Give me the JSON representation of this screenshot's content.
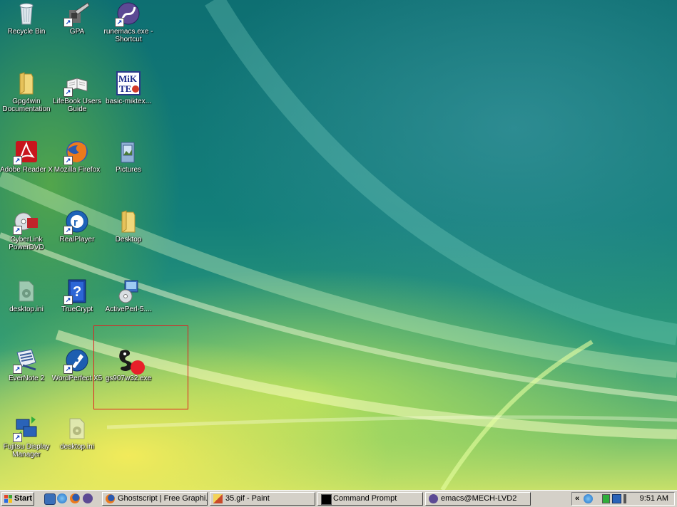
{
  "desktop_icons": [
    {
      "label": "Recycle Bin",
      "icon": "recycle-bin-icon"
    },
    {
      "label": "GPA",
      "icon": "gpa-shortcut-icon"
    },
    {
      "label": "runemacs.exe - Shortcut",
      "icon": "emacs-icon"
    },
    {
      "label": "Gpg4win Documentation",
      "icon": "folder-icon"
    },
    {
      "label": "LifeBook Users Guide",
      "icon": "book-icon"
    },
    {
      "label": "basic-miktex...",
      "icon": "miktex-icon"
    },
    {
      "label": "Adobe Reader X",
      "icon": "adobe-reader-icon"
    },
    {
      "label": "Mozilla Firefox",
      "icon": "firefox-icon"
    },
    {
      "label": "Pictures",
      "icon": "pictures-icon"
    },
    {
      "label": "CyberLink PowerDVD",
      "icon": "powerdvd-icon"
    },
    {
      "label": "RealPlayer",
      "icon": "realplayer-icon"
    },
    {
      "label": "Desktop",
      "icon": "folder-icon"
    },
    {
      "label": "desktop.ini",
      "icon": "ini-file-icon"
    },
    {
      "label": "TrueCrypt",
      "icon": "truecrypt-icon"
    },
    {
      "label": "ActivePerl-5....",
      "icon": "installer-icon"
    },
    {
      "label": "EverNote 2",
      "icon": "evernote-icon"
    },
    {
      "label": "WordPerfect X5",
      "icon": "wordperfect-icon"
    },
    {
      "label": "gs907w32.exe",
      "icon": "ghostscript-icon"
    },
    {
      "label": "Fujitsu Display Manager",
      "icon": "display-manager-icon"
    },
    {
      "label": "desktop.ini",
      "icon": "ini-file-icon"
    }
  ],
  "taskbar": {
    "start_label": "Start",
    "quick_launch": [
      "show-desktop-icon",
      "ie-icon",
      "firefox-icon",
      "emacs-icon"
    ],
    "tasks": [
      {
        "label": "Ghostscript | Free Graphi...",
        "icon": "firefox-icon"
      },
      {
        "label": "35.gif - Paint",
        "icon": "paint-icon"
      },
      {
        "label": "Command Prompt",
        "icon": "cmd-icon"
      },
      {
        "label": "emacs@MECH-LVD2",
        "icon": "emacs-icon"
      }
    ],
    "tray_chevron": "«",
    "clock": "9:51 AM"
  },
  "colors": {
    "selection": "#e02020",
    "taskbar": "#d4d0c8",
    "annotation_dot": "#e8202a"
  }
}
